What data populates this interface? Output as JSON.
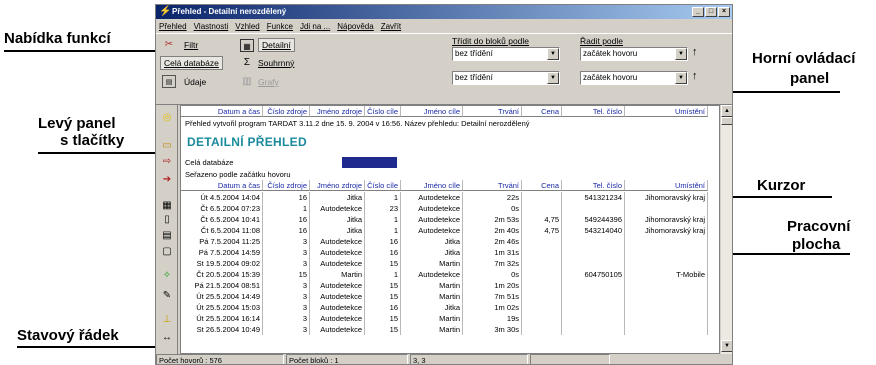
{
  "annotations": {
    "menu": "Nabídka funkcí",
    "top_panel_1": "Horní ovládací",
    "top_panel_2": "panel",
    "left_panel_1": "Levý panel",
    "left_panel_2": "s tlačítky",
    "cursor": "Kurzor",
    "workspace_1": "Pracovní",
    "workspace_2": "plocha",
    "statusbar": "Stavový řádek"
  },
  "window": {
    "title": "Přehled - Detailní nerozdělený",
    "min": "_",
    "max": "□",
    "close": "×"
  },
  "menu": [
    "Přehled",
    "Vlastnosti",
    "Vzhled",
    "Funkce",
    "Jdi na ...",
    "Nápověda",
    "Zavřít"
  ],
  "toolbar": {
    "filtr": "Filtr",
    "cela_databaze": "Celá databáze",
    "udaje": "Údaje",
    "detailni": "Detailní",
    "souhrnny": "Souhrnný",
    "grafy": "Grafy",
    "tridit_label": "Třídit do bloků podle",
    "tridit_1": "bez třídění",
    "tridit_2": "bez třídění",
    "radit_label": "Řadit podle",
    "radit_1": "začátek hovoru",
    "radit_2": "začátek hovoru"
  },
  "columns": [
    "Datum a čas",
    "Číslo zdroje",
    "Jméno zdroje",
    "Číslo cíle",
    "Jméno cíle",
    "Trvání",
    "Cena",
    "Tel. číslo",
    "Umístění"
  ],
  "info": {
    "created": "Přehled vytvořil program TARDAT 3.11.2 dne 15. 9. 2004 v 16:56. Název přehledu: Detailní nerozdělený",
    "title": "DETAILNÍ PŘEHLED",
    "scope": "Celá databáze",
    "sorted": "Seřazeno podle začátku hovoru"
  },
  "rows": [
    [
      "Út 4.5.2004 14:04",
      "16",
      "Jitka",
      "1",
      "Autodetekce",
      "22s",
      "",
      "541321234",
      "Jihomoravský kraj"
    ],
    [
      "Čt 6.5.2004 07:23",
      "1",
      "Autodetekce",
      "23",
      "Autodetekce",
      "0s",
      "",
      "",
      ""
    ],
    [
      "Čt 6.5.2004 10:41",
      "16",
      "Jitka",
      "1",
      "Autodetekce",
      "2m 53s",
      "4,75",
      "549244396",
      "Jihomoravský kraj"
    ],
    [
      "Čt 6.5.2004 11:08",
      "16",
      "Jitka",
      "1",
      "Autodetekce",
      "2m 40s",
      "4,75",
      "543214040",
      "Jihomoravský kraj"
    ],
    [
      "Pá 7.5.2004 11:25",
      "3",
      "Autodetekce",
      "16",
      "Jitka",
      "2m 46s",
      "",
      "",
      ""
    ],
    [
      "Pá 7.5.2004 14:59",
      "3",
      "Autodetekce",
      "16",
      "Jitka",
      "1m 31s",
      "",
      "",
      ""
    ],
    [
      "St 19.5.2004 09:02",
      "3",
      "Autodetekce",
      "15",
      "Martin",
      "7m 32s",
      "",
      "",
      ""
    ],
    [
      "Čt 20.5.2004 15:39",
      "15",
      "Martin",
      "1",
      "Autodetekce",
      "0s",
      "",
      "604750105",
      "T-Mobile"
    ],
    [
      "Pá 21.5.2004 08:51",
      "3",
      "Autodetekce",
      "15",
      "Martin",
      "1m 20s",
      "",
      "",
      ""
    ],
    [
      "Út 25.5.2004 14:49",
      "3",
      "Autodetekce",
      "15",
      "Martin",
      "7m 51s",
      "",
      "",
      ""
    ],
    [
      "Út 25.5.2004 15:03",
      "3",
      "Autodetekce",
      "16",
      "Jitka",
      "1m 02s",
      "",
      "",
      ""
    ],
    [
      "Út 25.5.2004 16:14",
      "3",
      "Autodetekce",
      "15",
      "Martin",
      "19s",
      "",
      "",
      ""
    ],
    [
      "St 26.5.2004 10:49",
      "3",
      "Autodetekce",
      "15",
      "Martin",
      "3m 30s",
      "",
      "",
      ""
    ]
  ],
  "status": {
    "calls": "Počet hovorů : 576",
    "blocks": "Počet bloků : 1",
    "pos": "3, 3"
  }
}
